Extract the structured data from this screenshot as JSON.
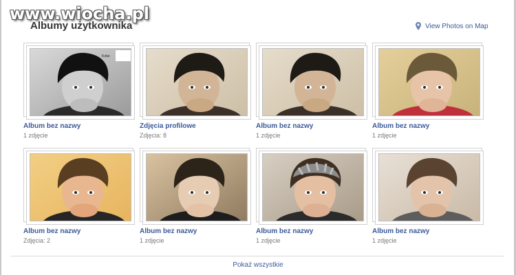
{
  "watermark": "www.wiocha.pl",
  "title": "Albumy użytkownika",
  "map_link": "View Photos on Map",
  "show_all": "Pokaż wszystkie",
  "albums": [
    {
      "title": "Album bez nazwy",
      "count": "1 zdjęcie",
      "tone": "bw",
      "photo_text": "Kobe"
    },
    {
      "title": "Zdjęcia profilowe",
      "count": "Zdjęcia: 8",
      "tone": "sepia"
    },
    {
      "title": "Album bez nazwy",
      "count": "1 zdjęcie",
      "tone": "sepia"
    },
    {
      "title": "Album bez nazwy",
      "count": "1 zdjęcie",
      "tone": "color-room"
    },
    {
      "title": "Album bez nazwy",
      "count": "Zdjęcia: 2",
      "tone": "warm"
    },
    {
      "title": "Album bez nazwy",
      "count": "1 zdjęcie",
      "tone": "dim"
    },
    {
      "title": "Album bez nazwy",
      "count": "1 zdjęcie",
      "tone": "beanie"
    },
    {
      "title": "Album bez nazwy",
      "count": "1 zdjęcie",
      "tone": "light"
    }
  ],
  "colors": {
    "link": "#3b5998",
    "muted": "#777777",
    "title": "#333333"
  }
}
